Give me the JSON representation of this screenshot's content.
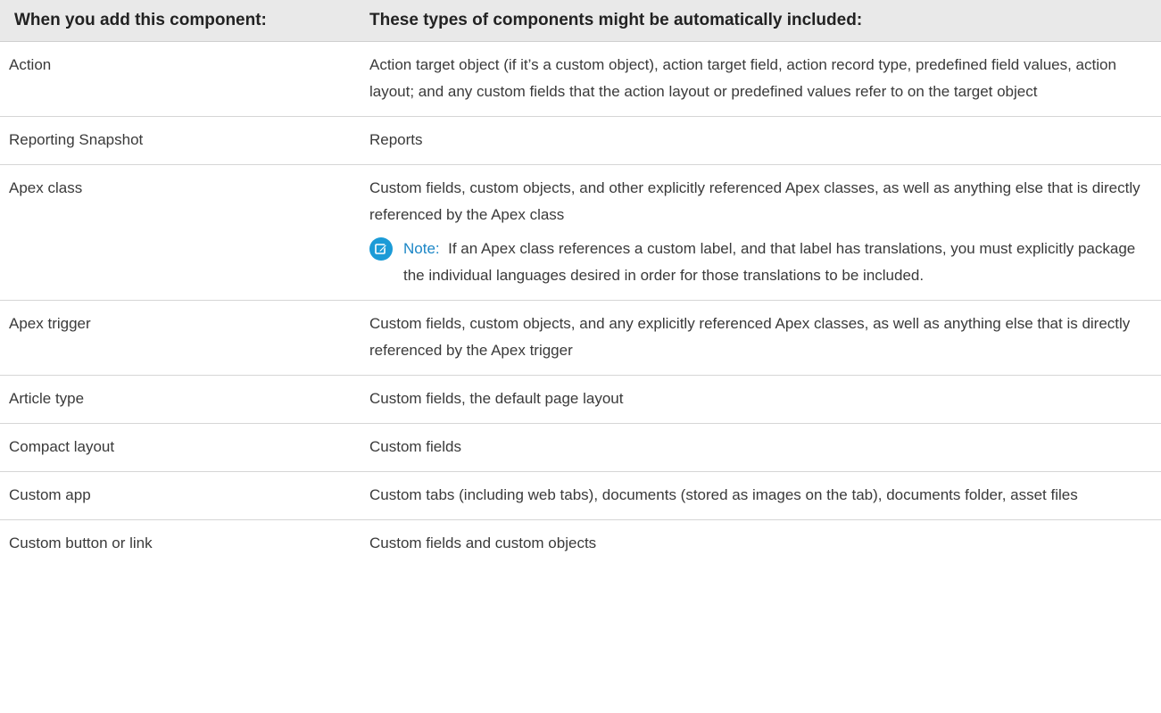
{
  "table": {
    "headers": {
      "component": "When you add this component:",
      "included": "These types of components might be automatically included:"
    },
    "rows": [
      {
        "component": "Action",
        "included": "Action target object (if it’s a custom object), action target field, action record type, predefined field values, action layout; and any custom fields that the action layout or predefined values refer to on the target object"
      },
      {
        "component": "Reporting Snapshot",
        "included": "Reports"
      },
      {
        "component": "Apex class",
        "included": "Custom fields, custom objects, and other explicitly referenced Apex classes, as well as anything else that is directly referenced by the Apex class",
        "note": {
          "label": "Note:",
          "text": "If an Apex class references a custom label, and that label has translations, you must explicitly package the individual languages desired in order for those translations to be included.",
          "icon": "edit-note-icon",
          "icon_color": "#1b9bd7"
        }
      },
      {
        "component": "Apex trigger",
        "included": "Custom fields, custom objects, and any explicitly referenced Apex classes, as well as anything else that is directly referenced by the Apex trigger"
      },
      {
        "component": "Article type",
        "included": "Custom fields, the default page layout"
      },
      {
        "component": "Compact layout",
        "included": "Custom fields"
      },
      {
        "component": "Custom app",
        "included": "Custom tabs (including web tabs), documents (stored as images on the tab), documents folder, asset files"
      },
      {
        "component": "Custom button or link",
        "included": "Custom fields and custom objects"
      }
    ]
  },
  "colors": {
    "header_bg": "#e9e9e9",
    "note_accent": "#1b86c6",
    "text": "#3a3a3a"
  }
}
